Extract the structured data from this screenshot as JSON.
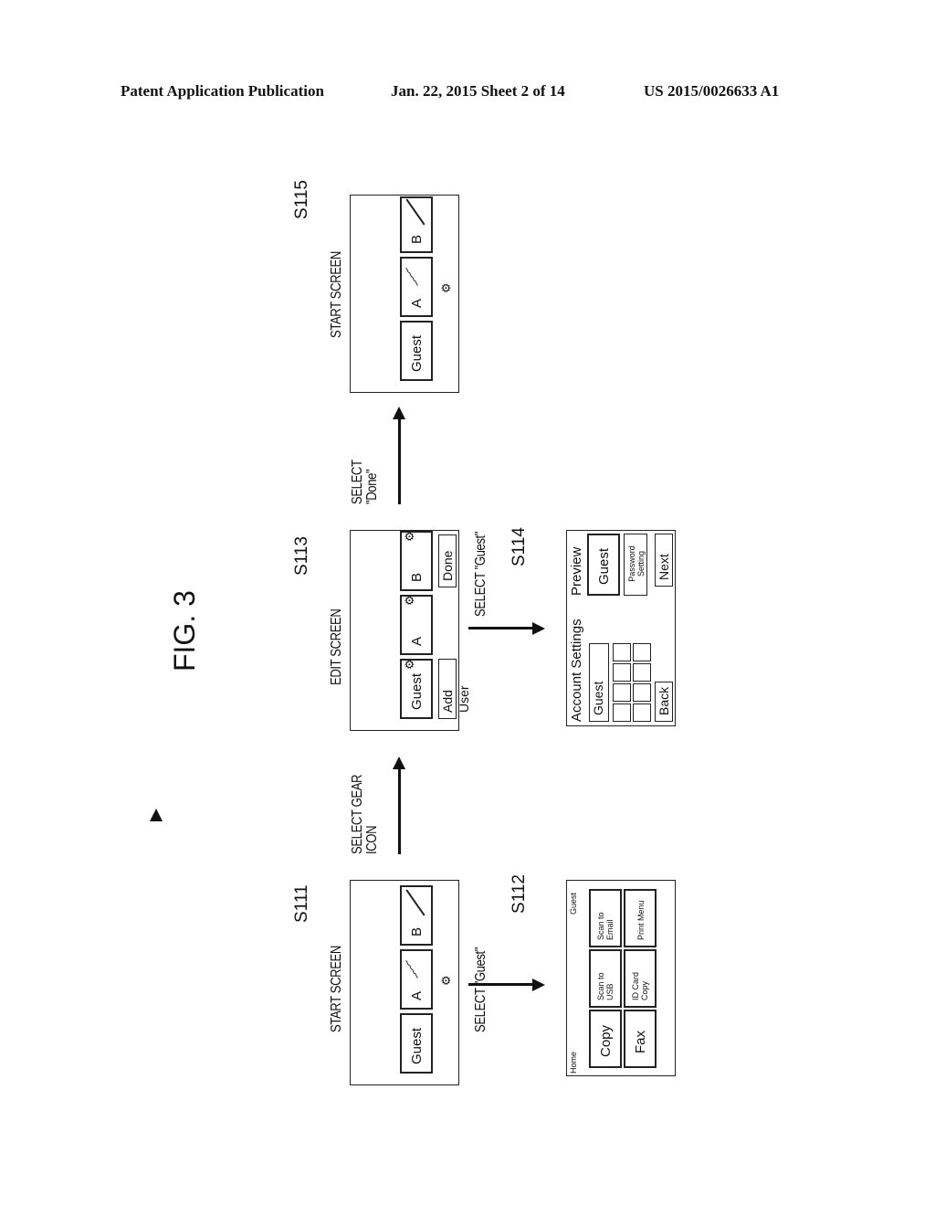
{
  "header": {
    "left": "Patent Application Publication",
    "middle": "Jan. 22, 2015   Sheet 2 of 14",
    "right": "US 2015/0026633 A1"
  },
  "figure": {
    "title": "FIG. 3",
    "s111": {
      "ref": "S111",
      "caption": "START SCREEN",
      "tiles": [
        "Guest",
        "A",
        "B"
      ]
    },
    "s112": {
      "ref": "S112",
      "home": "Home",
      "user": "Guest",
      "tiles": [
        "Copy",
        "Scan to USB",
        "Scan to Email",
        "Fax",
        "ID Card Copy",
        "Print Menu"
      ]
    },
    "s113": {
      "ref": "S113",
      "caption": "EDIT SCREEN",
      "tiles": [
        "Guest",
        "A",
        "B"
      ],
      "add_user": "Add User",
      "done": "Done"
    },
    "s114": {
      "ref": "S114",
      "title": "Account Settings",
      "name_value": "Guest",
      "preview": "Preview",
      "preview_tile": "Guest",
      "password_setting": "Password Setting",
      "back": "Back",
      "next": "Next"
    },
    "s115": {
      "ref": "S115",
      "caption": "START SCREEN",
      "tiles": [
        "Guest",
        "A",
        "B"
      ]
    },
    "transitions": {
      "gear": "SELECT GEAR ICON",
      "done": "SELECT \"Done\"",
      "guest1": "SELECT \"Guest\"",
      "guest2": "SELECT \"Guest\""
    }
  }
}
